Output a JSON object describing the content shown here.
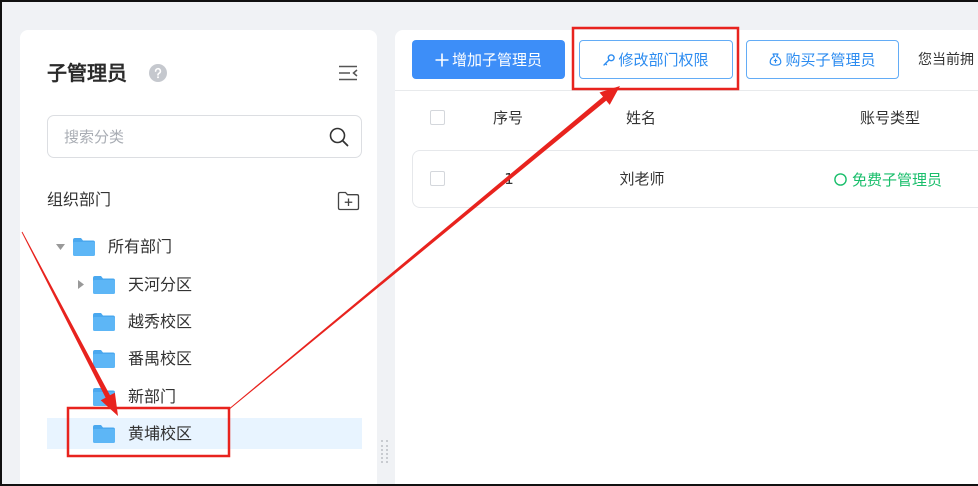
{
  "sidebar": {
    "title": "子管理员",
    "icons": {
      "help": "question-circle-icon",
      "collapse": "menu-fold-icon",
      "search": "search-icon",
      "add_folder": "folder-add-icon",
      "folder": "folder-icon"
    },
    "search": {
      "placeholder": "搜索分类",
      "value": ""
    },
    "section_title": "组织部门",
    "tree": {
      "root": {
        "label": "所有部门",
        "expanded": true,
        "children": [
          {
            "label": "天河分区",
            "expanded": false,
            "has_children": true
          },
          {
            "label": "越秀校区"
          },
          {
            "label": "番禺校区"
          },
          {
            "label": "新部门"
          },
          {
            "label": "黄埔校区",
            "selected": true
          }
        ]
      }
    }
  },
  "toolbar": {
    "add_button": {
      "label": "增加子管理员",
      "icon": "plus-icon"
    },
    "edit_permission_button": {
      "label": "修改部门权限",
      "icon": "key-icon"
    },
    "buy_button": {
      "label": "购买子管理员",
      "icon": "money-bag-icon"
    },
    "notice": "您当前拥"
  },
  "table": {
    "columns": [
      "序号",
      "姓名",
      "账号类型"
    ],
    "rows": [
      {
        "index": "1",
        "name": "刘老师",
        "account_type": "免费子管理员",
        "status_icon": "circle-icon",
        "selected": false
      }
    ]
  },
  "colors": {
    "primary": "#3d8ef8",
    "primary_text": "#2d8cf0",
    "success": "#19be6b",
    "selected_bg": "#e8f4ff",
    "folder": "#5db6f6",
    "annotation": "#e8231e",
    "page_bg": "#f0f2f5"
  }
}
